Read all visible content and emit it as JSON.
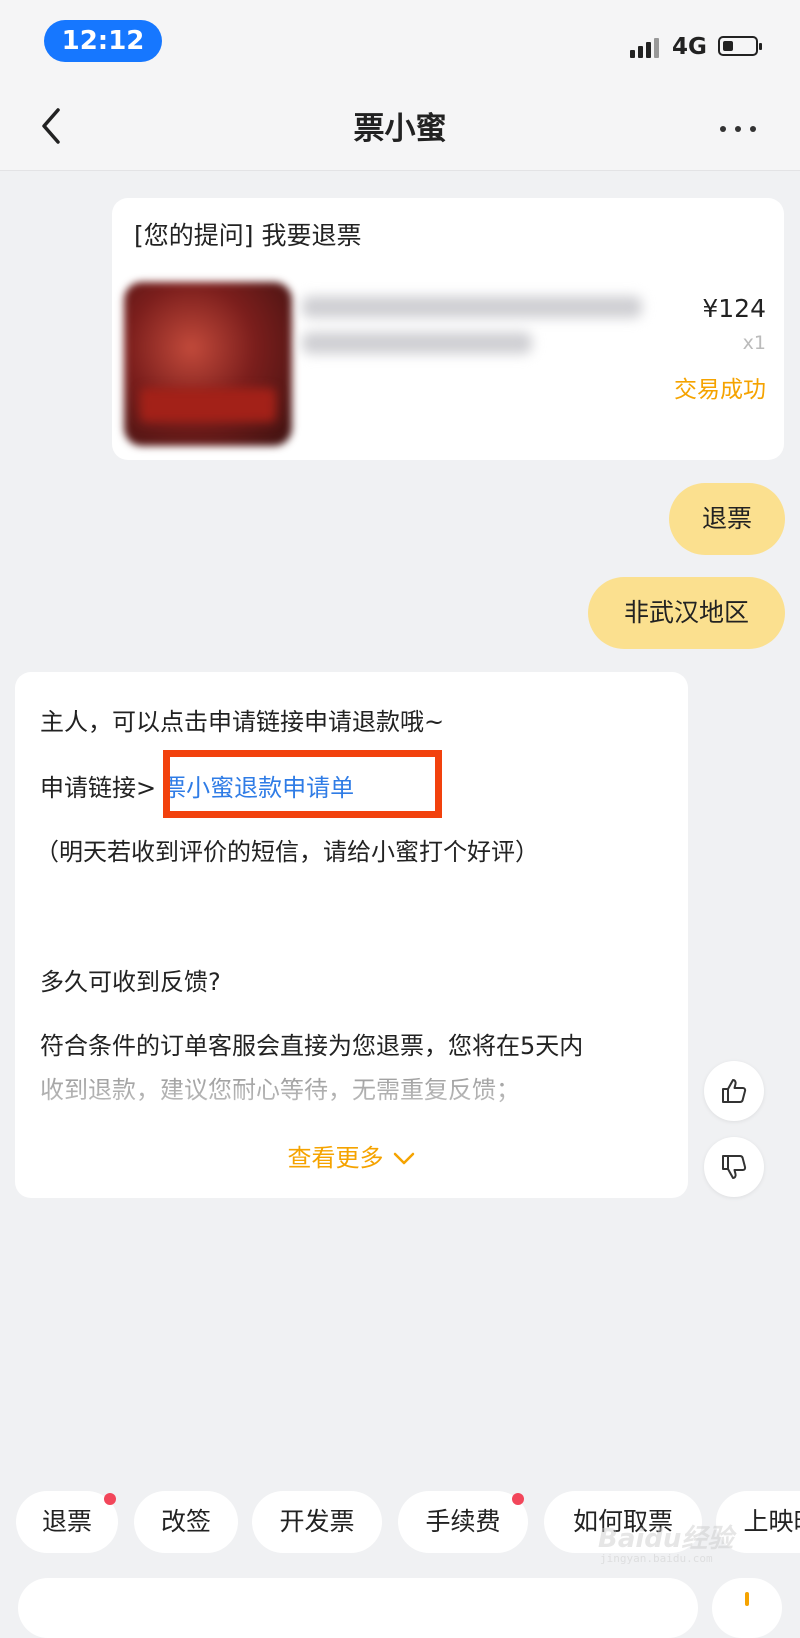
{
  "status_bar": {
    "time": "12:12",
    "network": "4G"
  },
  "nav": {
    "title": "票小蜜"
  },
  "question_card": {
    "question": "[您的提问] 我要退票",
    "price": "¥124",
    "quantity": "x1",
    "status": "交易成功"
  },
  "user_messages": [
    "退票",
    "非武汉地区"
  ],
  "reply": {
    "line1": "主人，可以点击申请链接申请退款哦~",
    "link_prefix": "申请链接>",
    "link_text": "票小蜜退款申请单",
    "line3": "（明天若收到评价的短信，请给小蜜打个好评）",
    "faq_title": "多久可收到反馈?",
    "faq_line1": "符合条件的订单客服会直接为您退票，您将在5天内",
    "faq_line2": "收到退款，建议您耐心等待，无需重复反馈；",
    "see_more": "查看更多"
  },
  "quick_replies": [
    {
      "label": "退票",
      "dot": true
    },
    {
      "label": "改签",
      "dot": false
    },
    {
      "label": "开发票",
      "dot": false
    },
    {
      "label": "手续费",
      "dot": true
    },
    {
      "label": "如何取票",
      "dot": false
    },
    {
      "label": "上映时",
      "dot": false
    }
  ],
  "watermark": {
    "text": "Baidu经验",
    "sub": "jingyan.baidu.com"
  },
  "colors": {
    "accent_yellow": "#fbe08f",
    "orange_text": "#f5a300",
    "link_blue": "#2f7ce6",
    "highlight_red": "#f2410d",
    "time_pill": "#1677ff"
  },
  "icons": {
    "back": "chevron-left-icon",
    "more": "more-horizontal-icon",
    "like": "thumbs-up-icon",
    "dislike": "thumbs-down-icon",
    "expand": "chevron-down-icon"
  }
}
